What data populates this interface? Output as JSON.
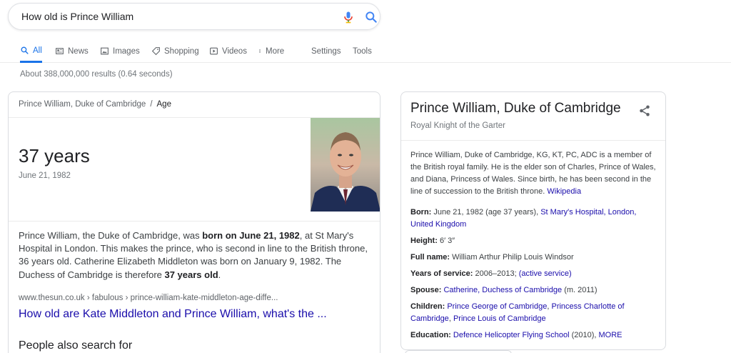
{
  "search": {
    "query": "How old is Prince William"
  },
  "tabs": [
    {
      "label": "All",
      "icon": "search-icon",
      "active": true
    },
    {
      "label": "News",
      "icon": "news-icon"
    },
    {
      "label": "Images",
      "icon": "image-icon"
    },
    {
      "label": "Shopping",
      "icon": "tag-icon"
    },
    {
      "label": "Videos",
      "icon": "play-icon"
    },
    {
      "label": "More",
      "icon": "more-vert-icon"
    },
    {
      "label": "Settings"
    },
    {
      "label": "Tools"
    }
  ],
  "result_stats": "About 388,000,000 results (0.64 seconds)",
  "answer_card": {
    "breadcrumb": {
      "entity": "Prince William, Duke of Cambridge",
      "separator": "/",
      "attribute": "Age"
    },
    "age": "37 years",
    "birth_date": "June 21, 1982",
    "snippet": {
      "p1": "Prince William, the Duke of Cambridge, was ",
      "b1": "born on June 21, 1982",
      "p2": ", at St Mary's Hospital in London. This makes the prince, who is second in line to the British throne, 36 years old. Catherine Elizabeth Middleton was born on January 9, 1982. The Duchess of Cambridge is therefore ",
      "b2": "37 years old",
      "p3": "."
    },
    "cite": "www.thesun.co.uk › fabulous › prince-william-kate-middleton-age-diffe...",
    "title": "How old are Kate Middleton and Prince William, what's the ...",
    "people_also_search": "People also search for"
  },
  "knowledge_panel": {
    "title": "Prince William, Duke of Cambridge",
    "subtitle": "Royal Knight of the Garter",
    "description": "Prince William, Duke of Cambridge, KG, KT, PC, ADC is a member of the British royal family. He is the elder son of Charles, Prince of Wales, and Diana, Princess of Wales. Since birth, he has been second in the line of succession to the British throne. ",
    "description_link": "Wikipedia",
    "born": {
      "label": "Born:",
      "text": " June 21, 1982 (age 37 years), ",
      "link": "St Mary's Hospital, London, United Kingdom"
    },
    "height": {
      "label": "Height:",
      "text": " 6′ 3″"
    },
    "full_name": {
      "label": "Full name:",
      "text": " William Arthur Philip Louis Windsor"
    },
    "years_of_service": {
      "label": "Years of service:",
      "text": " 2006–2013; ",
      "link": "(active service)"
    },
    "spouse": {
      "label": "Spouse:",
      "link": "Catherine, Duchess of Cambridge",
      "text": " (m. 2011)"
    },
    "children": {
      "label": "Children:",
      "link1": "Prince George of Cambridge",
      "sep1": ", ",
      "link2": "Princess Charlotte of Cambridge",
      "sep2": ", ",
      "link3": "Prince Louis of Cambridge"
    },
    "education": {
      "label": "Education:",
      "link": "Defence Helicopter Flying School",
      "text": " (2010), ",
      "more": "MORE"
    }
  },
  "colors": {
    "link": "#1a0dab",
    "accent": "#1a73e8",
    "muted": "#70757a"
  }
}
